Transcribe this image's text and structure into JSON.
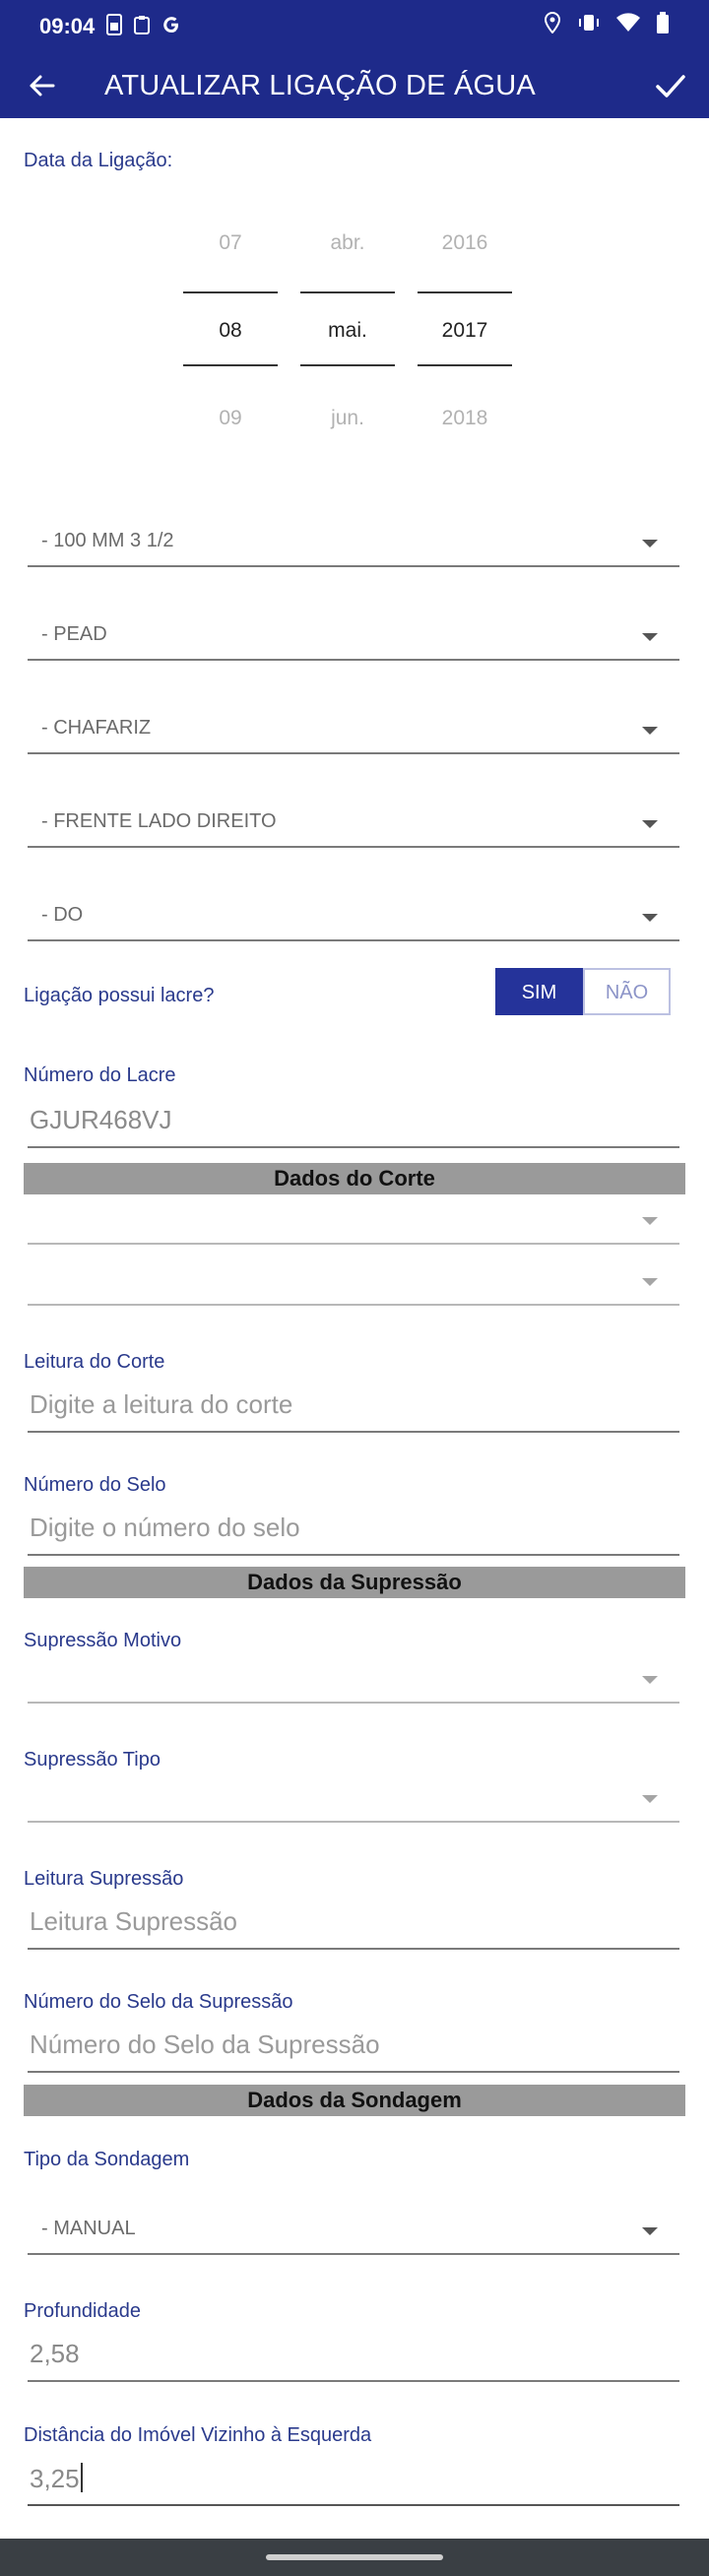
{
  "status_bar": {
    "time": "09:04"
  },
  "app_bar": {
    "title": "ATUALIZAR LIGAÇÃO DE ÁGUA"
  },
  "date": {
    "label": "Data da Ligação:",
    "day": {
      "prev": "07",
      "selected": "08",
      "next": "09"
    },
    "month": {
      "prev": "abr.",
      "selected": "mai.",
      "next": "jun."
    },
    "year": {
      "prev": "2016",
      "selected": "2017",
      "next": "2018"
    }
  },
  "dropdowns": {
    "d1": "- 100 MM 3 1/2",
    "d2": "- PEAD",
    "d3": "- CHAFARIZ",
    "d4": "- FRENTE LADO DIREITO",
    "d5": "- DO"
  },
  "lacre": {
    "question": "Ligação possui lacre?",
    "yes_label": "SIM",
    "no_label": "NÃO",
    "number_label": "Número do Lacre",
    "number_value": "GJUR468VJ"
  },
  "corte": {
    "header": "Dados do Corte",
    "leitura_label": "Leitura do Corte",
    "leitura_placeholder": "Digite a leitura do corte",
    "selo_label": "Número do Selo",
    "selo_placeholder": "Digite o número do selo"
  },
  "supressao": {
    "header": "Dados da Supressão",
    "motivo_label": "Supressão Motivo",
    "tipo_label": "Supressão Tipo",
    "leitura_label": "Leitura Supressão",
    "leitura_placeholder": "Leitura Supressão",
    "selo_label": "Número do Selo da Supressão",
    "selo_placeholder": "Número do Selo da Supressão"
  },
  "sondagem": {
    "header": "Dados da Sondagem",
    "tipo_label": "Tipo da Sondagem",
    "tipo_value": "- MANUAL",
    "profundidade_label": "Profundidade",
    "profundidade_value": "2,58",
    "distancia_label": "Distância do Imóvel Vizinho à Esquerda",
    "distancia_value": "3,25"
  },
  "colors": {
    "primary": "#1e2a8a",
    "label": "#2a3a8c",
    "section": "#9a9a9a"
  }
}
